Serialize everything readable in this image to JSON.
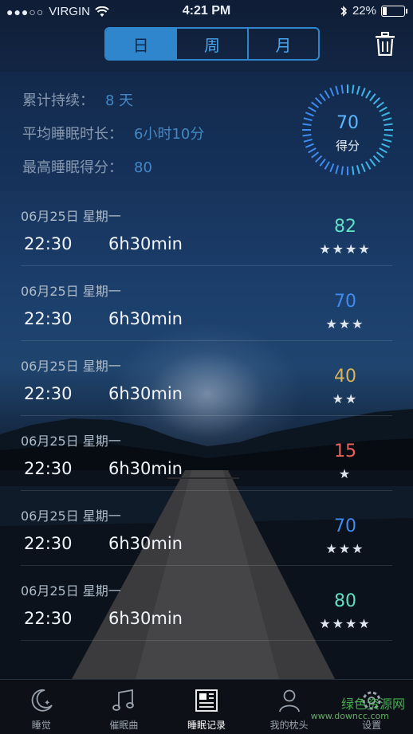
{
  "status": {
    "carrier": "VIRGIN",
    "time": "4:21 PM",
    "battery": "22%"
  },
  "segments": [
    "日",
    "周",
    "月"
  ],
  "summary": {
    "duration_label": "累计持续：",
    "duration_value": "8 天",
    "avg_label": "平均睡眠时长：",
    "avg_value": "6小时10分",
    "best_label": "最高睡眠得分：",
    "best_value": "80",
    "dial_score": "70",
    "dial_label": "得分"
  },
  "records": [
    {
      "date": "06月25日  星期一",
      "time": "22:30",
      "duration": "6h30min",
      "score": "82",
      "stars": "★★★★",
      "color": "#5fe0c4"
    },
    {
      "date": "06月25日  星期一",
      "time": "22:30",
      "duration": "6h30min",
      "score": "70",
      "stars": "★★★",
      "color": "#3f8cf0"
    },
    {
      "date": "06月25日  星期一",
      "time": "22:30",
      "duration": "6h30min",
      "score": "40",
      "stars": "★★",
      "color": "#d8b35b"
    },
    {
      "date": "06月25日  星期一",
      "time": "22:30",
      "duration": "6h30min",
      "score": "15",
      "stars": "★",
      "color": "#e8635a"
    },
    {
      "date": "06月25日  星期一",
      "time": "22:30",
      "duration": "6h30min",
      "score": "70",
      "stars": "★★★",
      "color": "#3f8cf0"
    },
    {
      "date": "06月25日  星期一",
      "time": "22:30",
      "duration": "6h30min",
      "score": "80",
      "stars": "★★★★",
      "color": "#5fe0c4"
    }
  ],
  "tabs": [
    "睡觉",
    "催眠曲",
    "睡眠记录",
    "我的枕头",
    "设置"
  ],
  "watermark": {
    "text": "绿色资源网",
    "url": "www.downcc.com"
  }
}
